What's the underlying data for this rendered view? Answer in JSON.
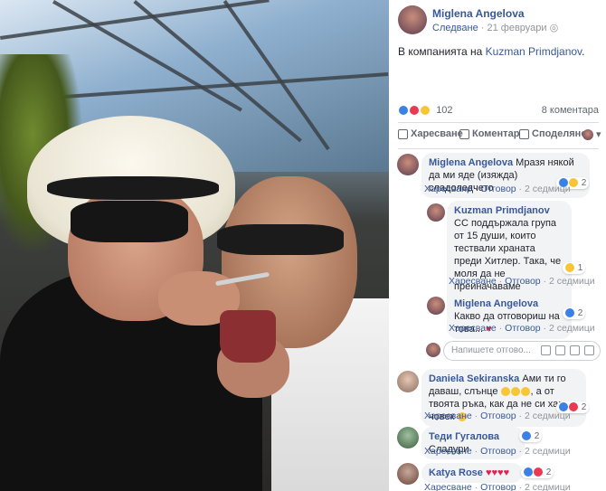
{
  "post": {
    "author": "Miglena Angelova",
    "follow": "Следване",
    "date": "21 февруари",
    "privacy_icon": "globe-icon",
    "with_prefix": "В компанията на",
    "tagged": "Kuzman Primdjanov",
    "tagged_suffix": "."
  },
  "reactions": {
    "count": "102",
    "comments": "8 коментара",
    "types": [
      "like",
      "love",
      "haha"
    ],
    "colors": {
      "like": "#3b80e6",
      "love": "#e83b53",
      "haha": "#f7c636"
    }
  },
  "actions": {
    "like": "Харесване",
    "comment": "Коментар",
    "share": "Споделяне"
  },
  "comments": [
    {
      "author": "Miglena Angelova",
      "text": "Мразя някой да ми яде (изяжда) сладоледчето",
      "like": "Харесване",
      "reply": "Отговор",
      "time": "2 седмици",
      "reactions": "2"
    },
    {
      "author": "Kuzman Primdjanov",
      "text": "СС поддържала група от 15 души, които тествали храната преди Хитлер. Така, че моля да не преиначаваме жертвоготовността ми.",
      "like": "Харесване",
      "reply": "Отговор",
      "time": "2 седмици",
      "reactions": "1"
    },
    {
      "author": "Miglena Angelova",
      "text": "Какво да отговориш на това...",
      "like": "Харесване",
      "reply": "Отговор",
      "time": "2 седмици",
      "reactions": "2"
    },
    {
      "author": "Daniela Sekiranska",
      "text": "Ами ти го даваш, слънце",
      "text2": ", а от твоята ръка, как да не си хапне човек",
      "like": "Харесване",
      "reply": "Отговор",
      "time": "2 седмици",
      "reactions": "2"
    },
    {
      "author": "Теди Гугалова",
      "text": "Сладури",
      "like": "Харесване",
      "reply": "Отговор",
      "time": "2 седмици",
      "reactions": "2"
    },
    {
      "author": "Katya Rose",
      "text": "",
      "like": "Харесване",
      "reply": "Отговор",
      "time": "2 седмици",
      "reactions": "2"
    }
  ],
  "compose": {
    "placeholder": "Напишете отгово..."
  }
}
